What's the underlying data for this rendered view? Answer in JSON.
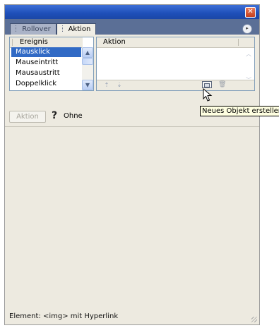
{
  "window": {
    "close_glyph": "✕"
  },
  "tabs": [
    {
      "label": "Rollover",
      "active": false
    },
    {
      "label": "Aktion",
      "active": true
    }
  ],
  "events_panel": {
    "header": "Ereignis",
    "items": [
      "Mausklick",
      "Mauseintritt",
      "Mausaustritt",
      "Doppelklick"
    ],
    "selected": "Mausklick"
  },
  "actions_panel": {
    "header": "Aktion",
    "toolbar": {
      "up_icon": "arrow-up-icon",
      "down_icon": "arrow-down-icon",
      "new_icon": "new-object-icon",
      "delete_icon": "trash-icon"
    }
  },
  "tooltip": "Neues Objekt erstellen",
  "action_row": {
    "button_label": "Aktion",
    "value_label": "Ohne"
  },
  "status": "Element: <img> mit Hyperlink",
  "colors": {
    "titlebar": "#1e4fb8",
    "selection": "#316ac5",
    "panel_bg": "#edeae0",
    "tooltip_bg": "#ffffe1"
  }
}
